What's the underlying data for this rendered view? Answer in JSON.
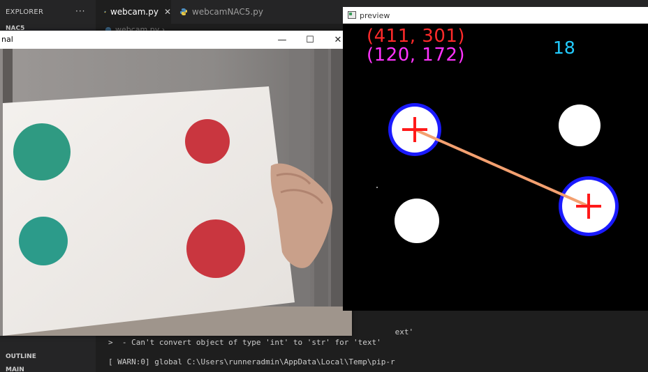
{
  "vscode": {
    "explorer_title": "EXPLORER",
    "explorer_more": "···",
    "folder_label": "NAC5",
    "outline_label": "OUTLINE",
    "timeline_label": "MAIN",
    "tabs": [
      {
        "label": "webcam.py",
        "close": "✕"
      },
      {
        "label": "webcamNAC5.py"
      }
    ],
    "breadcrumb": "webcam.py ›",
    "terminal_lines": [
      "                                                              ext'",
      ">  - Can't convert object of type 'int' to 'str' for 'text'",
      "[ WARN:0] global C:\\Users\\runneradmin\\AppData\\Local\\Temp\\pip-r"
    ]
  },
  "webcam_window": {
    "title": "nal",
    "minimize": "—",
    "maximize": "☐",
    "close": "✕"
  },
  "preview_window": {
    "title": "preview",
    "coord_red": "(411, 301)",
    "coord_magenta": "(120, 172)",
    "count": "18",
    "colors": {
      "red_text": "#ff2a2a",
      "magenta_text": "#ff33ff",
      "cyan_text": "#22ccff",
      "ring": "#1a1aff",
      "cross": "#ff1a1a",
      "line": "#f3a070"
    }
  }
}
